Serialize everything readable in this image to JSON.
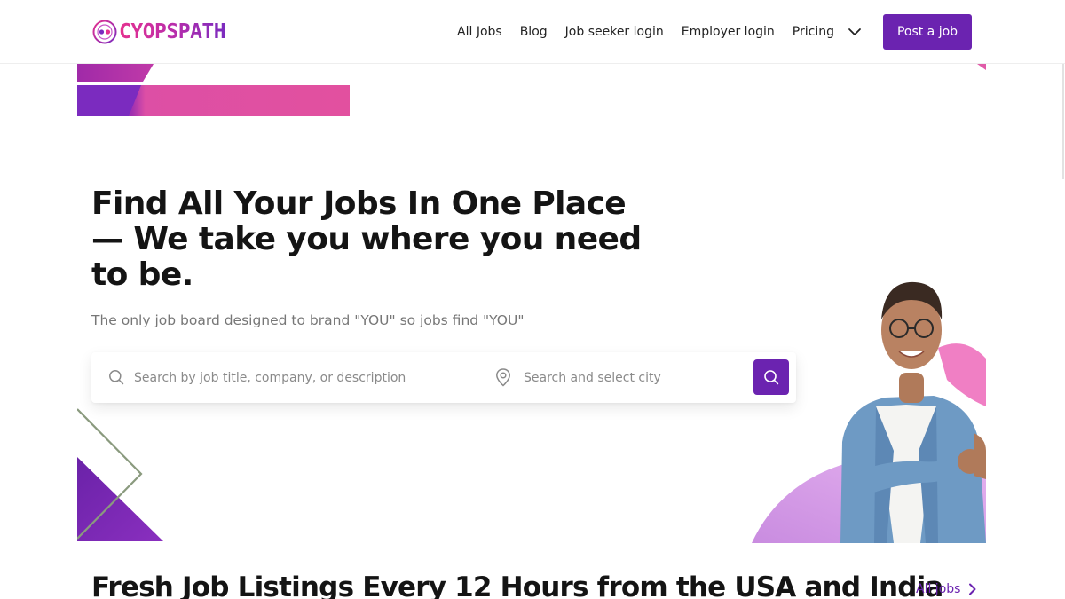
{
  "header": {
    "logo_text": "CYOPSPATH",
    "nav": {
      "all_jobs": "All Jobs",
      "blog": "Blog",
      "job_seeker_login": "Job seeker login",
      "employer_login": "Employer login",
      "pricing": "Pricing"
    },
    "post_job_label": "Post a job"
  },
  "hero": {
    "title": "Find All Your Jobs In One Place — We take you where you need to be.",
    "subtitle": "The only job board designed to brand \"YOU\" so jobs find \"YOU\"",
    "search": {
      "job_placeholder": "Search by job title, company, or description",
      "city_placeholder": "Search and select city"
    }
  },
  "listings": {
    "title": "Fresh Job Listings Every 12 Hours from the USA and India",
    "all_jobs_link": "All jobs"
  },
  "colors": {
    "brand_purple": "#6b23b0",
    "pink": "#e2509f",
    "light_violet": "#dca0ec",
    "olive_line": "#8a9a7e"
  },
  "icons": [
    "chevron-down-icon",
    "search-icon",
    "location-pin-icon",
    "chevron-right-icon"
  ]
}
